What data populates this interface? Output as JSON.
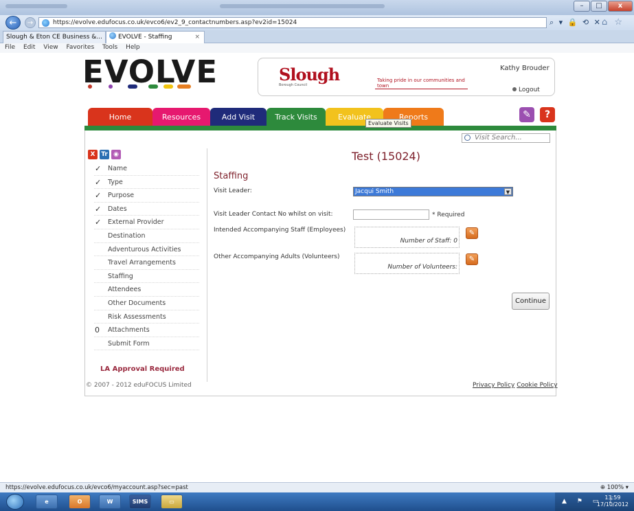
{
  "browser": {
    "url": "https://evolve.edufocus.co.uk/evco6/ev2_9_contactnumbers.asp?ev2id=15024",
    "tabs": [
      {
        "label": "Slough & Eton CE Business &..."
      },
      {
        "label": "EVOLVE - Staffing"
      }
    ],
    "menu": [
      "File",
      "Edit",
      "View",
      "Favorites",
      "Tools",
      "Help"
    ],
    "status_url": "https://evolve.edufocus.co.uk/evco6/myaccount.asp?sec=past",
    "zoom": "100%"
  },
  "header": {
    "logo": "EVOLVE",
    "logo_dot_colors": [
      "#c0392b",
      "#8e44ad",
      "#1f2b7a",
      "#2d8a3c",
      "#f1c40f",
      "#e67e22"
    ],
    "council_name": "Slough",
    "council_sub": "Borough Council",
    "tagline": "Taking pride in our communities and town",
    "user_name": "Kathy Brouder",
    "logout_label": "Logout"
  },
  "nav": {
    "tabs": [
      {
        "label": "Home",
        "color": "#d9341c"
      },
      {
        "label": "Resources",
        "color": "#e6196f"
      },
      {
        "label": "Add Visit",
        "color": "#1f2b7a"
      },
      {
        "label": "Track Visits",
        "color": "#2d8a3c"
      },
      {
        "label": "Evaluate",
        "color": "#f2c21d"
      },
      {
        "label": "Reports",
        "color": "#ef7a1a"
      }
    ],
    "tooltip": "Evaluate Visits"
  },
  "search": {
    "placeholder": "Visit Search..."
  },
  "sidebar": {
    "icons": [
      {
        "label": "X",
        "color": "#d9341c"
      },
      {
        "label": "Tr",
        "color": "#2a6fb3"
      },
      {
        "label": "◉",
        "color": "#b25ab5"
      }
    ],
    "items": [
      {
        "label": "Name",
        "mark": "✓"
      },
      {
        "label": "Type",
        "mark": "✓"
      },
      {
        "label": "Purpose",
        "mark": "✓"
      },
      {
        "label": "Dates",
        "mark": "✓"
      },
      {
        "label": "External Provider",
        "mark": "✓"
      },
      {
        "label": "Destination",
        "mark": ""
      },
      {
        "label": "Adventurous Activities",
        "mark": ""
      },
      {
        "label": "Travel Arrangements",
        "mark": ""
      },
      {
        "label": "Staffing",
        "mark": ""
      },
      {
        "label": "Attendees",
        "mark": ""
      },
      {
        "label": "Other Documents",
        "mark": ""
      },
      {
        "label": "Risk Assessments",
        "mark": ""
      },
      {
        "label": "Attachments",
        "mark": "0"
      },
      {
        "label": "Submit Form",
        "mark": ""
      }
    ],
    "approval": "LA Approval Required"
  },
  "main": {
    "visit_title": "Test (15024)",
    "section_title": "Staffing",
    "visit_leader_label": "Visit Leader:",
    "visit_leader_value": "Jacqui Smith",
    "contact_label": "Visit Leader Contact No whilst on visit:",
    "contact_value": "",
    "required_label": "* Required",
    "staff_label": "Intended Accompanying Staff (Employees)",
    "staff_count_text": "Number of Staff: 0",
    "volunteers_label": "Other Accompanying Adults (Volunteers)",
    "volunteers_count_text": "Number of Volunteers:",
    "continue_label": "Continue"
  },
  "footer": {
    "copyright": "© 2007 - 2012 eduFOCUS Limited",
    "privacy": "Privacy Policy",
    "cookie": "Cookie Policy"
  },
  "taskbar": {
    "apps": [
      "SIMS"
    ],
    "time": "13:59",
    "date": "17/10/2012"
  }
}
